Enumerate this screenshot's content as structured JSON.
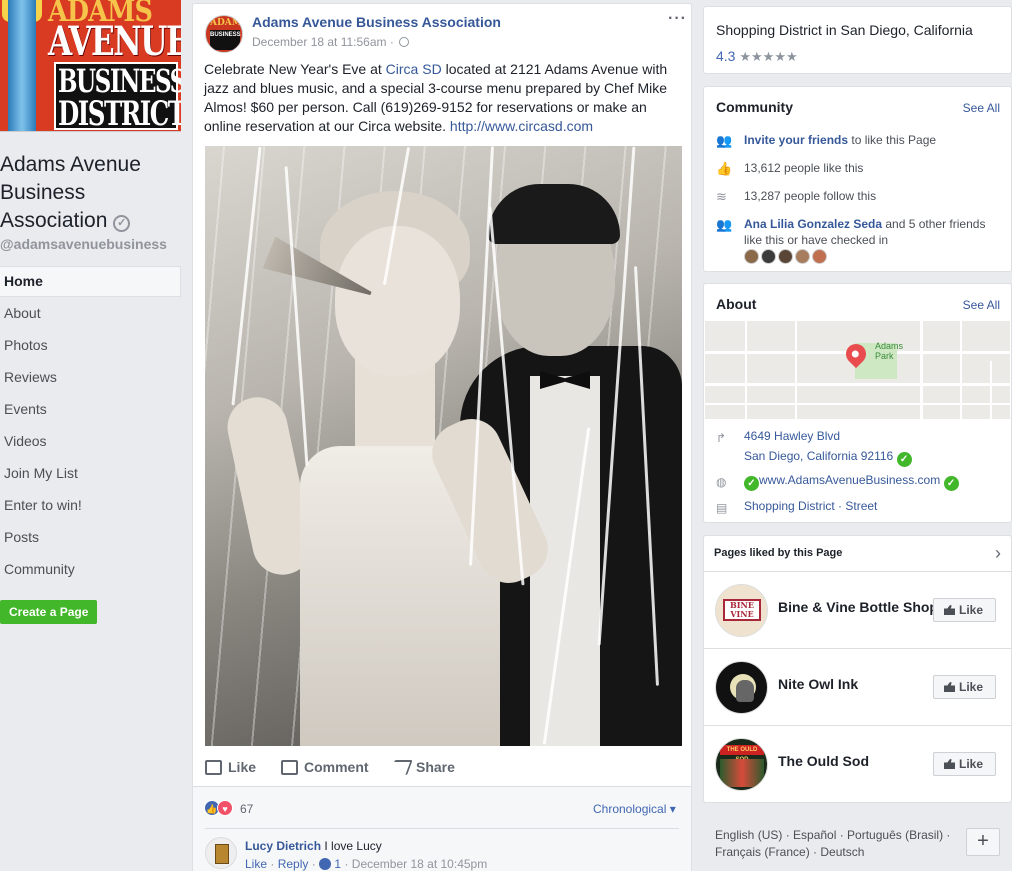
{
  "page": {
    "name": "Adams Avenue Business Association",
    "handle": "@adamsavenuebusiness",
    "logo_text": [
      "ADAMS",
      "AVENUE",
      "BUSINESS",
      "DISTRICT"
    ],
    "verified_icon": "verified-icon"
  },
  "nav": {
    "items": [
      {
        "label": "Home",
        "active": true
      },
      {
        "label": "About"
      },
      {
        "label": "Photos"
      },
      {
        "label": "Reviews"
      },
      {
        "label": "Events"
      },
      {
        "label": "Videos"
      },
      {
        "label": "Join My List"
      },
      {
        "label": "Enter to win!"
      },
      {
        "label": "Posts"
      },
      {
        "label": "Community"
      }
    ],
    "create_page": "Create a Page"
  },
  "post": {
    "author": "Adams Avenue Business Association",
    "time": "December 18 at 11:56am ·",
    "menu": "···",
    "text_before": "Celebrate New Year's Eve at ",
    "text_link": "Circa SD",
    "text_after": " located at 2121 Adams Avenue with jazz and blues music, and a special 3-course menu prepared by Chef Mike Almos! $60 per person. Call (619)269-9152 for reservations or make an online reservation at our Circa website. ",
    "url": "http://www.circasd.com",
    "actions": {
      "like": "Like",
      "comment": "Comment",
      "share": "Share"
    },
    "reactions": {
      "count": "67",
      "like_icon": "👍",
      "love_icon": "♥"
    },
    "sort": "Chronological ▾",
    "comment": {
      "author": "Lucy Dietrich",
      "text": "I love Lucy",
      "like": "Like",
      "reply": "Reply",
      "likes": "1",
      "time": "December 18 at 10:45pm"
    }
  },
  "place": {
    "type": "Shopping District in San Diego, California",
    "rating": "4.3",
    "stars": "★★★★★"
  },
  "community": {
    "title": "Community",
    "see_all": "See All",
    "invite_link": "Invite your friends",
    "invite_rest": " to like this Page",
    "likes": "13,612 people like this",
    "follows": "13,287 people follow this",
    "friend_name": "Ana Lilia Gonzalez Seda",
    "friend_rest": " and 5 other friends like this or have checked in",
    "friend_avatar_colors": [
      "#8a6a4a",
      "#3b3b3b",
      "#5a4636",
      "#a77d5d",
      "#c07050"
    ]
  },
  "about": {
    "title": "About",
    "see_all": "See All",
    "map_label": "Adams Park",
    "map_label_line1": "Adams",
    "map_label_line2": "Park",
    "address1": "4649 Hawley Blvd",
    "address2": "San Diego, California 92116",
    "website": "www.AdamsAvenueBusiness.com",
    "category": "Shopping District · Street"
  },
  "liked_pages": {
    "title": "Pages liked by this Page",
    "like_label": "Like",
    "items": [
      {
        "name": "Bine & Vine Bottle Shop",
        "avatar_text": "BINE VINE"
      },
      {
        "name": "Nite Owl Ink"
      },
      {
        "name": "The Ould Sod",
        "avatar_text": "THE OULD SOD"
      }
    ]
  },
  "footer": {
    "languages": "English (US) · Español · Português (Brasil) · Français (France) · Deutsch",
    "plus": "+"
  }
}
